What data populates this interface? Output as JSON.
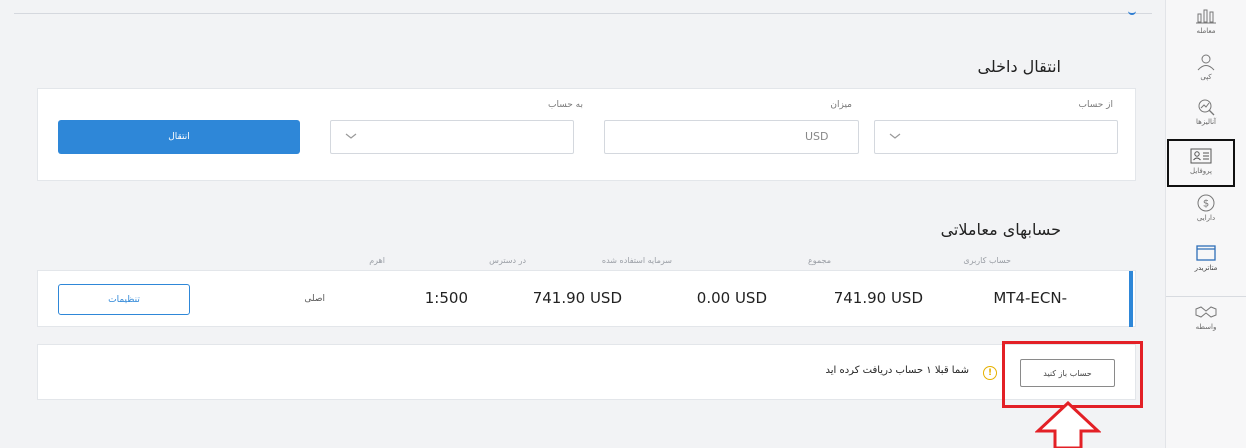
{
  "transfer": {
    "title": "انتقال داخلی",
    "from_label": "از حساب",
    "amount_label": "میزان",
    "to_label": "به حساب",
    "amount_value": "USD",
    "button_label": "انتقال"
  },
  "accounts": {
    "title": "حسابهای معاملاتی",
    "columns": [
      "حساب کاربری",
      "مجموع",
      "سرمایه استفاده شده",
      "در دسترس",
      "اهرم"
    ],
    "row": {
      "account": "MT4-ECN-",
      "total": "741.90 USD",
      "used": "0.00 USD",
      "available": "741.90 USD",
      "leverage": "1:500",
      "type": "اصلی",
      "settings_label": "تنظیمات"
    }
  },
  "notice": {
    "text": "شما قبلا ۱ حساب دریافت کرده اید",
    "open_account_label": "حساب باز کنید",
    "warning_symbol": "!"
  },
  "sidebar": {
    "items": [
      {
        "label": "معامله",
        "icon": "trade-icon"
      },
      {
        "label": "کپی",
        "icon": "copy-icon"
      },
      {
        "label": "آنالیزها",
        "icon": "analysis-icon"
      },
      {
        "label": "پروفایل",
        "icon": "profile-icon",
        "active": true
      },
      {
        "label": "دارایی",
        "icon": "dollar-icon"
      },
      {
        "label": "متاتریدر",
        "icon": "metatrader-icon"
      },
      {
        "label": "واسطه",
        "icon": "partner-icon"
      }
    ]
  },
  "colors": {
    "accent": "#2e87d8",
    "highlight": "#e32026",
    "warning": "#e6b100"
  }
}
